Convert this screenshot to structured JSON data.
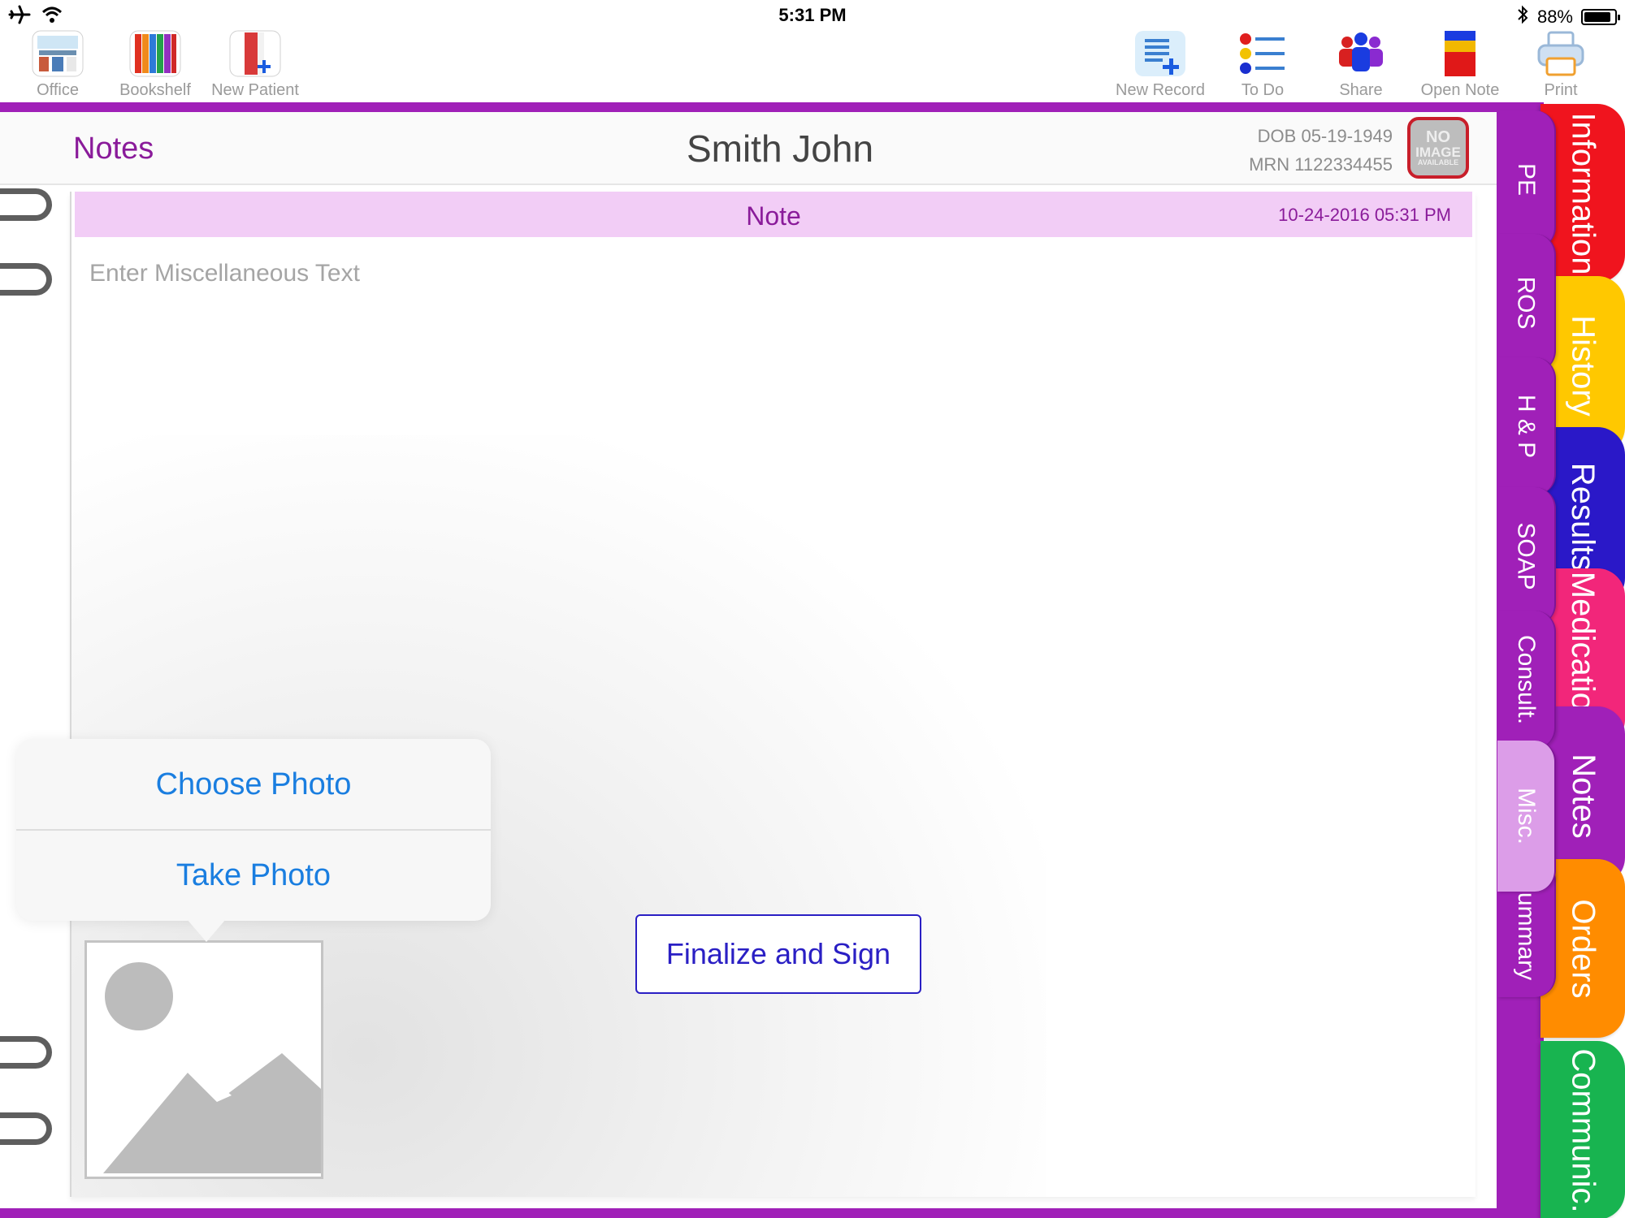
{
  "status_bar": {
    "time": "5:31 PM",
    "battery_text": "88%",
    "battery_level": 0.88
  },
  "toolbar": {
    "left": [
      {
        "label": "Office",
        "icon": "office-icon"
      },
      {
        "label": "Bookshelf",
        "icon": "bookshelf-icon"
      },
      {
        "label": "New Patient",
        "icon": "new-patient-icon"
      }
    ],
    "right": [
      {
        "label": "New Record",
        "icon": "new-record-icon"
      },
      {
        "label": "To Do",
        "icon": "todo-list-icon"
      },
      {
        "label": "Share",
        "icon": "share-people-icon"
      },
      {
        "label": "Open Note",
        "icon": "open-note-icon"
      },
      {
        "label": "Print",
        "icon": "printer-icon"
      }
    ]
  },
  "header": {
    "section_title": "Notes",
    "patient_name": "Smith John",
    "dob": "DOB 05-19-1949",
    "mrn": "MRN 1122334455",
    "avatar_line1": "NO",
    "avatar_line2": "IMAGE",
    "avatar_line3": "AVAILABLE"
  },
  "note": {
    "title": "Note",
    "datetime": "10-24-2016 05:31 PM",
    "placeholder": "Enter Miscellaneous Text",
    "finalize_label": "Finalize and Sign"
  },
  "popover": {
    "choose_photo": "Choose Photo",
    "take_photo": "Take Photo"
  },
  "inner_tabs": [
    {
      "label": "PE",
      "color": "#a020b8"
    },
    {
      "label": "ROS",
      "color": "#a020b8"
    },
    {
      "label": "H & P",
      "color": "#a020b8"
    },
    {
      "label": "SOAP",
      "color": "#a020b8"
    },
    {
      "label": "Consult.",
      "color": "#a020b8"
    },
    {
      "label": "Misc.",
      "color": "#dc9de8",
      "active": true
    },
    {
      "label": "Summary",
      "color": "#a020b8"
    }
  ],
  "outer_tabs": [
    {
      "label": "Information",
      "color": "#f0141e"
    },
    {
      "label": "History",
      "color": "#ffc800"
    },
    {
      "label": "Results",
      "color": "#2a18c8"
    },
    {
      "label": "Medications",
      "color": "#f2267a"
    },
    {
      "label": "Notes",
      "color": "#a020b8"
    },
    {
      "label": "Orders",
      "color": "#ff8c00"
    },
    {
      "label": "Communic.",
      "color": "#18b450"
    }
  ]
}
